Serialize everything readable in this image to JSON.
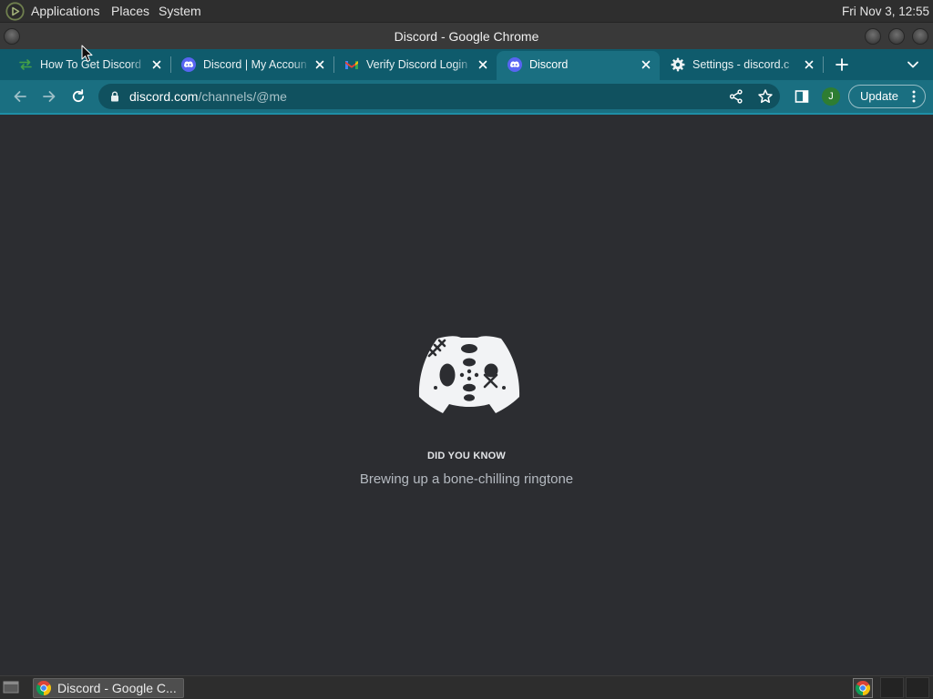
{
  "theme": {
    "panel_bg": "#2e2e2e",
    "titlebar_bg": "#393939",
    "tabstrip_bg": "#0f5b6c",
    "active_tab_bg": "#1a6f81",
    "omnibox_bg": "#10515f",
    "accent_line": "#1e8ea6",
    "content_bg": "#2c2d31",
    "taskbar_bg": "#2d2d2d",
    "avatar_bg": "#2e7d32",
    "discord_blurple": "#5865f2"
  },
  "panel": {
    "logo_icon": "distro-logo-icon",
    "menus": [
      "Applications",
      "Places",
      "System"
    ],
    "clock": "Fri Nov 3, 12:55"
  },
  "window": {
    "title": "Discord - Google Chrome"
  },
  "tabs": [
    {
      "title": "How To Get Discord",
      "icon": "swap-arrows-icon",
      "active": false
    },
    {
      "title": "Discord | My Accoun",
      "icon": "discord-icon",
      "active": false
    },
    {
      "title": "Verify Discord Login",
      "icon": "gmail-icon",
      "active": false
    },
    {
      "title": "Discord",
      "icon": "discord-icon",
      "active": true
    },
    {
      "title": "Settings - discord.c",
      "icon": "gear-icon",
      "active": false
    }
  ],
  "address_bar": {
    "host": "discord.com",
    "path": "/channels/@me"
  },
  "profile": {
    "initial": "J"
  },
  "update_button": {
    "label": "Update"
  },
  "loading_screen": {
    "logo_icon": "discord-zombie-logo",
    "heading": "DID YOU KNOW",
    "tip": "Brewing up a bone-chilling ringtone"
  },
  "taskbar": {
    "window_button": "Discord - Google C...",
    "tray_icons": [
      "chrome-icon"
    ]
  }
}
